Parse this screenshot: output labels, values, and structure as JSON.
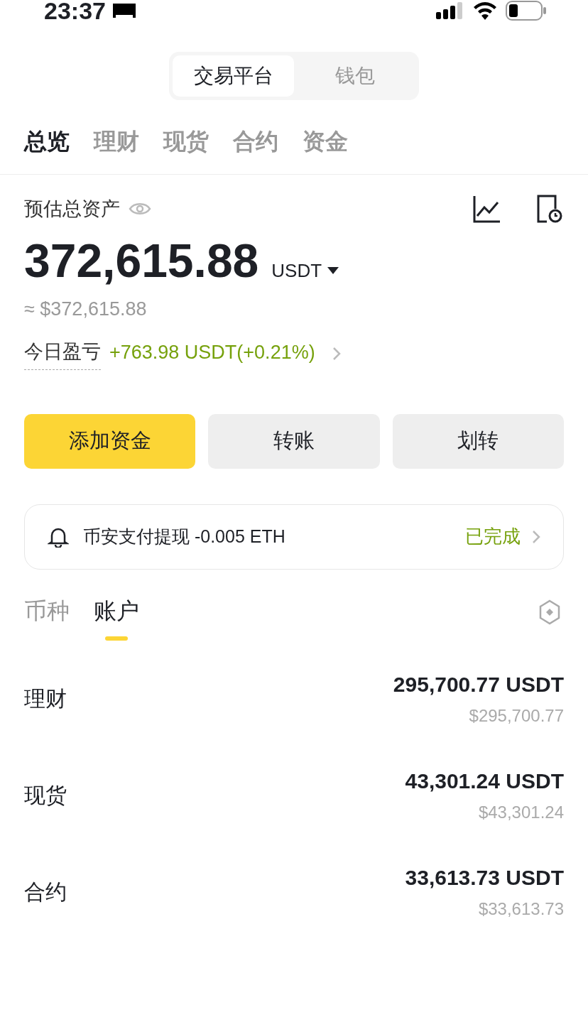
{
  "status_bar": {
    "time": "23:37"
  },
  "segment": [
    {
      "label": "交易平台",
      "selected": true
    },
    {
      "label": "钱包",
      "selected": false
    }
  ],
  "tabs": [
    {
      "label": "总览",
      "selected": true
    },
    {
      "label": "理财",
      "selected": false
    },
    {
      "label": "现货",
      "selected": false
    },
    {
      "label": "合约",
      "selected": false
    },
    {
      "label": "资金",
      "selected": false
    }
  ],
  "summary": {
    "label": "预估总资产",
    "amount": "372,615.88",
    "currency": "USDT",
    "fiat": "≈ $372,615.88",
    "pnl_label": "今日盈亏",
    "pnl_value": "+763.98 USDT(+0.21%)"
  },
  "actions": [
    {
      "label": "添加资金",
      "kind": "primary"
    },
    {
      "label": "转账",
      "kind": "secondary"
    },
    {
      "label": "划转",
      "kind": "secondary"
    }
  ],
  "notice": {
    "text": "币安支付提现 -0.005 ETH",
    "status": "已完成"
  },
  "sub_tabs": [
    {
      "label": "币种",
      "selected": false
    },
    {
      "label": "账户",
      "selected": true
    }
  ],
  "accounts": [
    {
      "name": "理财",
      "amount": "295,700.77 USDT",
      "fiat": "$295,700.77"
    },
    {
      "name": "现货",
      "amount": "43,301.24 USDT",
      "fiat": "$43,301.24"
    },
    {
      "name": "合约",
      "amount": "33,613.73 USDT",
      "fiat": "$33,613.73"
    }
  ]
}
